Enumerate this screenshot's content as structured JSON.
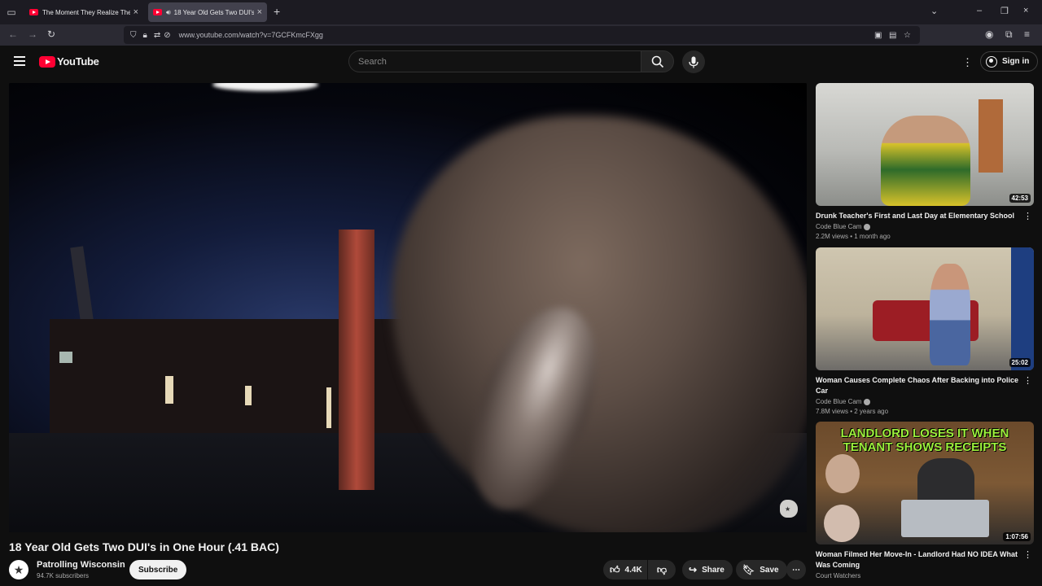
{
  "browser": {
    "tabs": [
      {
        "title": "The Moment They Realize Thei",
        "active": false
      },
      {
        "title": "18 Year Old Gets Two DUI's",
        "active": true
      }
    ],
    "url": "www.youtube.com/watch?v=7GCFKmcFXgg"
  },
  "header": {
    "logo_text": "YouTube",
    "search_placeholder": "Search",
    "signin_label": "Sign in"
  },
  "video": {
    "title": "18 Year Old Gets Two DUI's in One Hour (.41 BAC)",
    "channel": "Patrolling Wisconsin",
    "subscribers": "94.7K subscribers",
    "subscribe_label": "Subscribe",
    "likes": "4.4K",
    "share_label": "Share",
    "save_label": "Save"
  },
  "recommendations": [
    {
      "title": "Drunk Teacher's First and Last Day at Elementary School",
      "channel": "Code Blue Cam",
      "meta": "2.2M views • 1 month ago",
      "duration": "42:53",
      "verified": true
    },
    {
      "title": "Woman Causes Complete Chaos After Backing into Police Car",
      "channel": "Code Blue Cam",
      "meta": "7.8M views • 2 years ago",
      "duration": "25:02",
      "verified": true
    },
    {
      "title": "Woman Filmed Her Move-In - Landlord Had NO IDEA What Was Coming",
      "channel": "Court Watchers",
      "meta": "",
      "duration": "1:07:56",
      "verified": false,
      "thumb_text": "LANDLORD LOSES IT WHEN TENANT SHOWS RECEIPTS"
    }
  ],
  "colors": {
    "accent": "#ff0033",
    "background": "#0f0f0f"
  }
}
